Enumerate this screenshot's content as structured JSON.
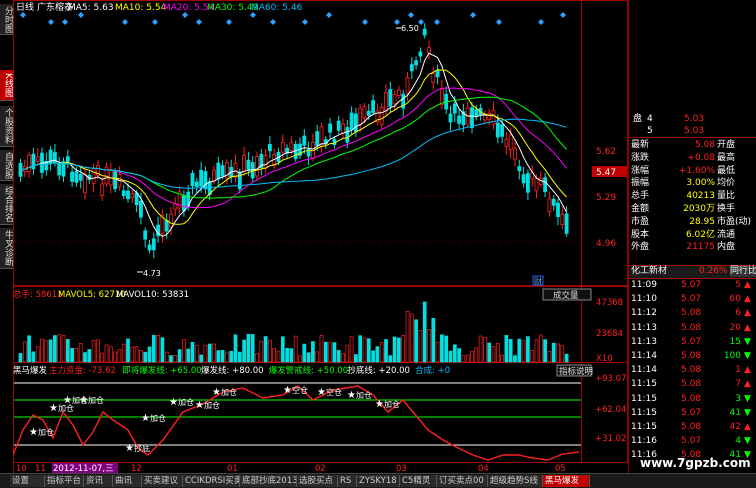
{
  "header": {
    "period": "日线",
    "stock": "广东榕泰",
    "ma": [
      {
        "label": "MA5: 5.63",
        "color": "#ffffff"
      },
      {
        "label": "MA10: 5.54",
        "color": "#ffff00"
      },
      {
        "label": "MA20: 5.54",
        "color": "#ff00ff"
      },
      {
        "label": "MA30: 5.49",
        "color": "#00ff00"
      },
      {
        "label": "MA60: 5.46",
        "color": "#00bfff"
      }
    ]
  },
  "left_tabs": [
    {
      "label": "分时图",
      "active": false
    },
    {
      "label": "K线图",
      "active": true
    },
    {
      "label": "个股资料",
      "active": false
    },
    {
      "label": "自选股",
      "active": false
    },
    {
      "label": "综合排名",
      "active": false
    },
    {
      "label": "牛叉诊断",
      "active": false
    }
  ],
  "price_axis": {
    "ticks": [
      "5.62",
      "5.47",
      "5.29",
      "4.96"
    ],
    "current": "5.47"
  },
  "price_annotations": {
    "high": "6.50",
    "low": "4.73",
    "marker": "财"
  },
  "volume_panel": {
    "label": "总手: 58611",
    "mavol5": "MAVOL5: 62710",
    "mavol10": "MAVOL10: 53831",
    "button": "成交量",
    "ticks": [
      "47368",
      "23684",
      "X10"
    ]
  },
  "indicator_panel": {
    "name": "黑马爆发",
    "items": [
      {
        "text": "主力资金: -73.62",
        "color": "#ff2020"
      },
      {
        "text": "即将爆发线: +65.00",
        "color": "#00ff00"
      },
      {
        "text": "爆发线: +80.00",
        "color": "#ffffff"
      },
      {
        "text": "爆发警戒线: +50.00",
        "color": "#00ff00"
      },
      {
        "text": "抄底线: +20.00",
        "color": "#ffffff"
      },
      {
        "text": "合成: +0",
        "color": "#00bfff"
      }
    ],
    "button": "指标说明",
    "ticks": [
      "+93.07",
      "+62.04",
      "+31.02"
    ],
    "signals": [
      "加仓",
      "加仓",
      "加仓",
      "加仓",
      "加仓",
      "加仓",
      "加仓",
      "加仓",
      "空仓",
      "空仓",
      "加仓",
      "加仓",
      "抄底"
    ]
  },
  "x_axis": {
    "labels": [
      "10",
      "11",
      "2012-11-07,三",
      "12",
      "01",
      "02",
      "03",
      "04",
      "05"
    ]
  },
  "quote": {
    "top_rows": [
      {
        "k": "盘",
        "n": "4",
        "v": "5.03"
      },
      {
        "k": "",
        "n": "5",
        "v": "5.03"
      }
    ],
    "rows": [
      {
        "l": "最新",
        "v": "5.08",
        "r": "开盘",
        "vc": "#ff2020"
      },
      {
        "l": "涨跌",
        "v": "+0.08",
        "r": "最高",
        "vc": "#ff2020"
      },
      {
        "l": "涨幅",
        "v": "+1.60%",
        "r": "最低",
        "vc": "#ff2020"
      },
      {
        "l": "振幅",
        "v": "3.00%",
        "r": "均价",
        "vc": "#ffff00"
      },
      {
        "l": "总手",
        "v": "40213",
        "r": "量比",
        "vc": "#ffff00"
      },
      {
        "l": "金额",
        "v": "2030万",
        "r": "换手",
        "vc": "#ffff00"
      },
      {
        "l": "市盈",
        "v": "28.95",
        "r": "市盈(动)",
        "vc": "#ffff00"
      },
      {
        "l": "股本",
        "v": "6.02亿",
        "r": "流通",
        "vc": "#ffff00"
      },
      {
        "l": "外盘",
        "v": "21175",
        "r": "内盘",
        "vc": "#ff2020"
      }
    ],
    "right_partial": [
      "6.",
      "6.",
      "1"
    ],
    "sector": {
      "name": "化工新材",
      "change": "0.26%",
      "tab": "同行比较"
    },
    "ticks": [
      {
        "t": "11:09",
        "p": "5.07",
        "q": "5",
        "dir": "up"
      },
      {
        "t": "11:10",
        "p": "5.07",
        "q": "60",
        "dir": "up"
      },
      {
        "t": "11:12",
        "p": "5.08",
        "q": "6",
        "dir": "up"
      },
      {
        "t": "11:13",
        "p": "5.08",
        "q": "20",
        "dir": "up"
      },
      {
        "t": "11:13",
        "p": "5.07",
        "q": "15",
        "dir": "down"
      },
      {
        "t": "11:14",
        "p": "5.08",
        "q": "100",
        "dir": "down"
      },
      {
        "t": "11:14",
        "p": "5.08",
        "q": "1",
        "dir": "up"
      },
      {
        "t": "11:15",
        "p": "5.08",
        "q": "7",
        "dir": "up"
      },
      {
        "t": "11:15",
        "p": "5.08",
        "q": "3",
        "dir": "down"
      },
      {
        "t": "11:15",
        "p": "5.07",
        "q": "41",
        "dir": "down"
      },
      {
        "t": "11:15",
        "p": "5.08",
        "q": "42",
        "dir": "up"
      },
      {
        "t": "11:16",
        "p": "5.07",
        "q": "4",
        "dir": "down"
      },
      {
        "t": "11:16",
        "p": "5.08",
        "q": "41",
        "dir": "down"
      }
    ]
  },
  "bottom_tabs": [
    {
      "label": "设置",
      "active": false
    },
    {
      "label": "指标平台",
      "active": false
    },
    {
      "label": "资讯",
      "active": false
    },
    {
      "label": "曲讯",
      "active": false
    },
    {
      "label": "买卖建议",
      "active": false
    },
    {
      "label": "CCIKDRSI买卖",
      "active": false
    },
    {
      "label": "底部抄底2013",
      "active": false
    },
    {
      "label": "选股买点",
      "active": false
    },
    {
      "label": "RS",
      "active": false
    },
    {
      "label": "ZYSKY18",
      "active": false
    },
    {
      "label": "C5精灵",
      "active": false
    },
    {
      "label": "订买卖点00",
      "active": false
    },
    {
      "label": "超级趋势S线",
      "active": false
    },
    {
      "label": "黑马爆发",
      "active": true
    }
  ],
  "watermark": "www.7gpzb.com",
  "colors": {
    "up": "#ff2020",
    "down": "#00e0e0",
    "frame": "#a00000"
  }
}
